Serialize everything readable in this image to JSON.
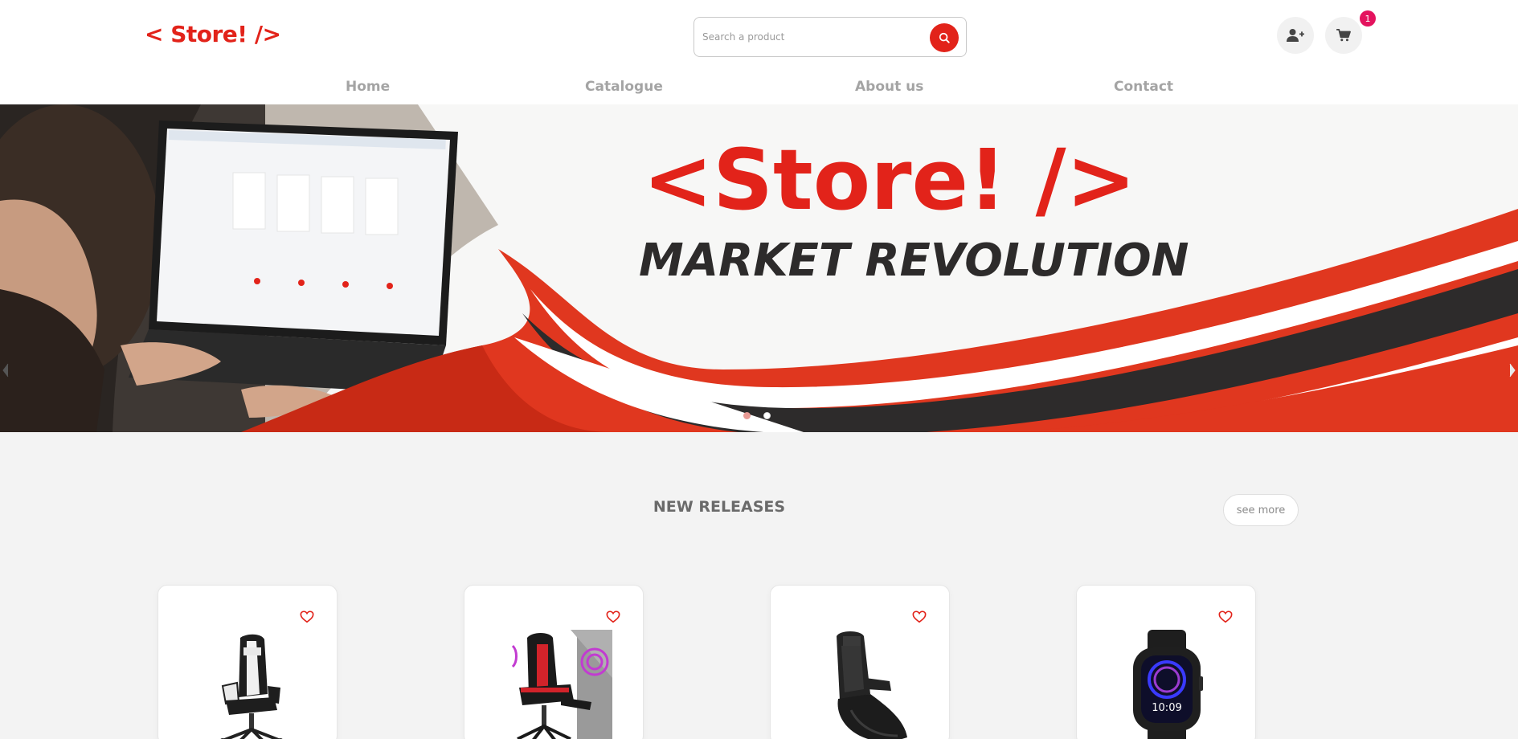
{
  "header": {
    "logo": "< Store! />",
    "search": {
      "placeholder": "Search a product",
      "value": ""
    },
    "cart_count": "1"
  },
  "nav": {
    "items": [
      {
        "label": "Home"
      },
      {
        "label": "Catalogue"
      },
      {
        "label": "About us"
      },
      {
        "label": "Contact"
      }
    ]
  },
  "banner": {
    "logo_text": "<Store! />",
    "tagline": "MARKET REVOLUTION",
    "slides_total": 2,
    "active_slide": 2
  },
  "new_releases": {
    "title": "NEW RELEASES",
    "see_more_label": "see more",
    "products": [
      {
        "icon": "gaming-chair-white-icon"
      },
      {
        "icon": "gaming-chair-red-icon"
      },
      {
        "icon": "rocker-chair-icon"
      },
      {
        "icon": "smartwatch-icon",
        "screen_time": "10:09"
      }
    ]
  },
  "colors": {
    "accent": "#e2231a",
    "badge": "#e4135e",
    "nav_text": "#a4a4a4",
    "dark": "#2d2b2b"
  }
}
